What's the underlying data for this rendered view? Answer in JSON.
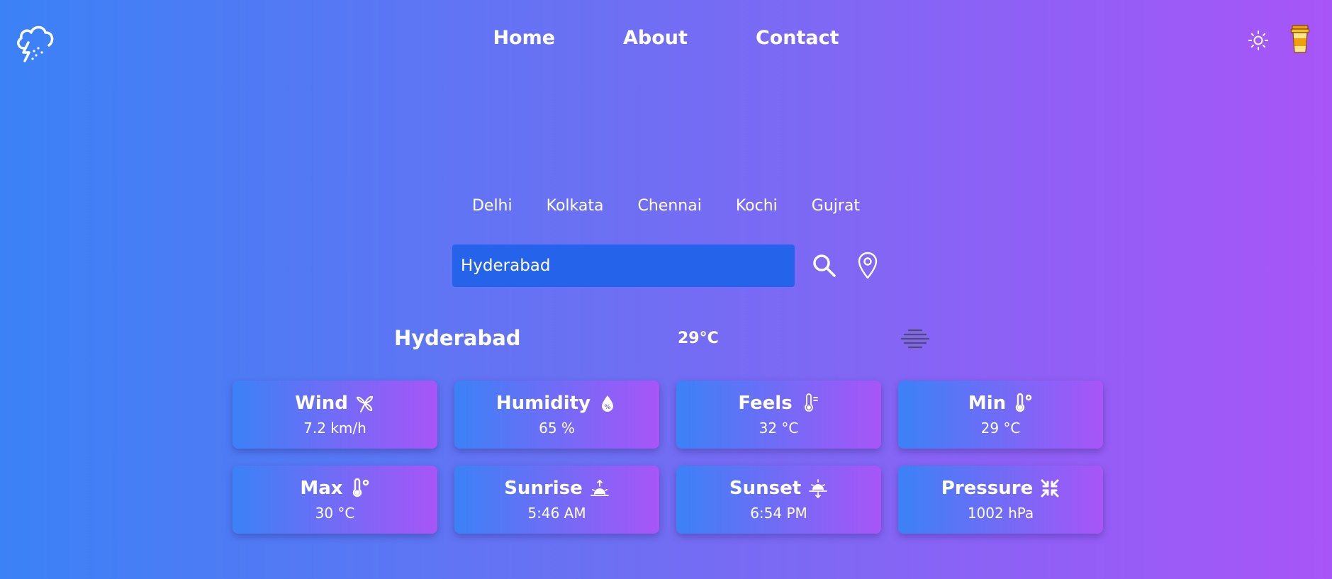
{
  "nav": {
    "items": [
      "Home",
      "About",
      "Contact"
    ]
  },
  "header": {
    "logo_icon": "thunderstorm-cloud-icon",
    "theme_icon": "sun-icon",
    "coffee_icon": "coffee-cup-icon"
  },
  "cities": [
    "Delhi",
    "Kolkata",
    "Chennai",
    "Kochi",
    "Gujrat"
  ],
  "search": {
    "value": "Hyderabad",
    "search_icon": "search-icon",
    "location_icon": "location-pin-icon"
  },
  "summary": {
    "city": "Hyderabad",
    "temperature": "29°C",
    "condition_icon": "haze-icon"
  },
  "cards": [
    {
      "title": "Wind",
      "value": "7.2 km/h",
      "icon": "wind-icon"
    },
    {
      "title": "Humidity",
      "value": "65 %",
      "icon": "humidity-icon"
    },
    {
      "title": "Feels",
      "value": "32 °C",
      "icon": "thermometer-feels-icon"
    },
    {
      "title": "Min",
      "value": "29 °C",
      "icon": "thermometer-min-icon"
    },
    {
      "title": "Max",
      "value": "30 °C",
      "icon": "thermometer-max-icon"
    },
    {
      "title": "Sunrise",
      "value": "5:46 AM",
      "icon": "sunrise-icon"
    },
    {
      "title": "Sunset",
      "value": "6:54 PM",
      "icon": "sunset-icon"
    },
    {
      "title": "Pressure",
      "value": "1002 hPa",
      "icon": "pressure-icon"
    }
  ],
  "colors": {
    "gradient_start": "#3b82f6",
    "gradient_end": "#a855f7",
    "input_bg": "#2563eb",
    "coffee": "#f59e0b"
  }
}
